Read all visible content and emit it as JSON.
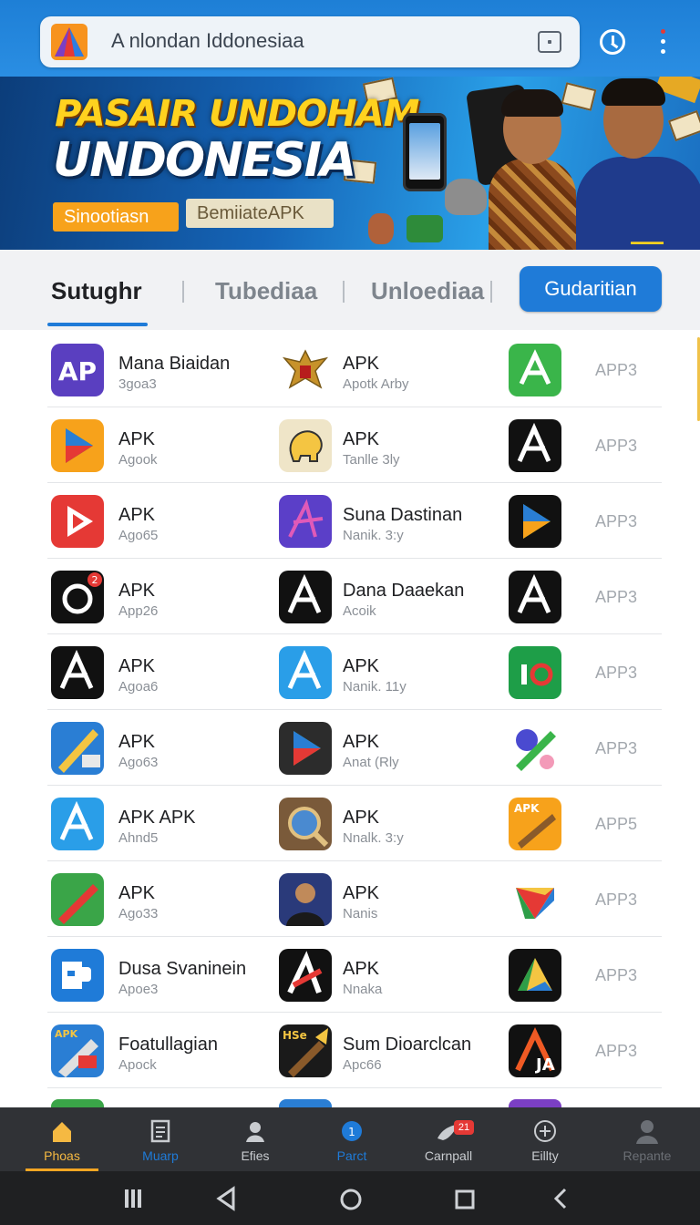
{
  "browser": {
    "url_text": "A nlondan Iddonesiaa"
  },
  "banner": {
    "title_line1": "PASAIR UNDOHAM",
    "title_line2": "UNDONESIA",
    "chip_left": "Sinootiasn",
    "chip_right": "BemiiateAPK"
  },
  "tabs": {
    "items": [
      "Sutughr",
      "Tubediaa",
      "Unloediaa"
    ],
    "action_button": "Gudaritian"
  },
  "apps": [
    {
      "c1": {
        "name": "Mana Biaidan",
        "sub": "3goa3",
        "icon": "ap-purple-icon"
      },
      "c2": {
        "name": "APK",
        "sub": "Apotk Arby",
        "icon": "garuda-emblem-icon"
      },
      "c3": {
        "label": "APP3",
        "icon": "ap-green-icon"
      }
    },
    {
      "c1": {
        "name": "APK",
        "sub": "Agook",
        "icon": "play-orange-icon"
      },
      "c2": {
        "name": "APK",
        "sub": "Tanlle 3ly",
        "icon": "elephant-icon"
      },
      "c3": {
        "label": "APP3",
        "icon": "ap-black-icon"
      }
    },
    {
      "c1": {
        "name": "APK",
        "sub": "Ago65",
        "icon": "play-red-icon"
      },
      "c2": {
        "name": "Suna Dastinan",
        "sub": "Nanik. 3:y",
        "icon": "a-purple-icon"
      },
      "c3": {
        "label": "APP3",
        "icon": "play-store-icon"
      }
    },
    {
      "c1": {
        "name": "APK",
        "sub": "App26",
        "icon": "ring-icon"
      },
      "c2": {
        "name": "Dana Daaekan",
        "sub": "Acoik",
        "icon": "ap-black-icon"
      },
      "c3": {
        "label": "APP3",
        "icon": "ap-black-icon"
      }
    },
    {
      "c1": {
        "name": "APK",
        "sub": "Agoa6",
        "icon": "ap-black-icon"
      },
      "c2": {
        "name": "APK",
        "sub": "Nanik. 11y",
        "icon": "ap-blue-icon"
      },
      "c3": {
        "label": "APP3",
        "icon": "io-green-icon"
      }
    },
    {
      "c1": {
        "name": "APK",
        "sub": "Ago63",
        "icon": "tools-blue-icon"
      },
      "c2": {
        "name": "APK",
        "sub": "Anat (Rly",
        "icon": "play-dark-icon"
      },
      "c3": {
        "label": "APP3",
        "icon": "toolkit-icon"
      }
    },
    {
      "c1": {
        "name": "APK APK",
        "sub": "Ahnd5",
        "icon": "ap-blue-icon"
      },
      "c2": {
        "name": "APK",
        "sub": "Nnalk. 3:y",
        "icon": "magnifier-icon"
      },
      "c3": {
        "label": "APP5",
        "icon": "apk-tools-icon"
      }
    },
    {
      "c1": {
        "name": "APK",
        "sub": "Ago33",
        "icon": "tool-green-icon"
      },
      "c2": {
        "name": "APK",
        "sub": "Nanis",
        "icon": "portrait-icon"
      },
      "c3": {
        "label": "APP3",
        "icon": "gdrive-icon"
      }
    },
    {
      "c1": {
        "name": "Dusa Svaninein",
        "sub": "Apoe3",
        "icon": "ep-blue-icon"
      },
      "c2": {
        "name": "APK",
        "sub": "Nnaka",
        "icon": "a-red-icon"
      },
      "c3": {
        "label": "APP3",
        "icon": "drive-black-icon"
      }
    },
    {
      "c1": {
        "name": "Foatullagian",
        "sub": "Apock",
        "icon": "apk-syringe-icon"
      },
      "c2": {
        "name": "Sum Dioarclcan",
        "sub": "Apc66",
        "icon": "brush-icon"
      },
      "c3": {
        "label": "APP3",
        "icon": "ja-black-icon"
      }
    }
  ],
  "bottom_nav": [
    {
      "label": "Phoas",
      "icon": "home-icon"
    },
    {
      "label": "Muarp",
      "icon": "document-icon"
    },
    {
      "label": "Efies",
      "icon": "profile-icon"
    },
    {
      "label": "Parct",
      "icon": "globe-icon"
    },
    {
      "label": "Carnpall",
      "icon": "bird-icon"
    },
    {
      "label": "Eillty",
      "icon": "plus-circle-icon"
    },
    {
      "label": "Repante",
      "icon": "user-icon"
    }
  ],
  "badges": {
    "carnpall": "21",
    "parct": "1"
  },
  "colors": {
    "accent": "#1f7bd8",
    "topbar": "#2a8ee3",
    "nav_bg": "#303236",
    "nav_active_underline": "#f5a623"
  }
}
